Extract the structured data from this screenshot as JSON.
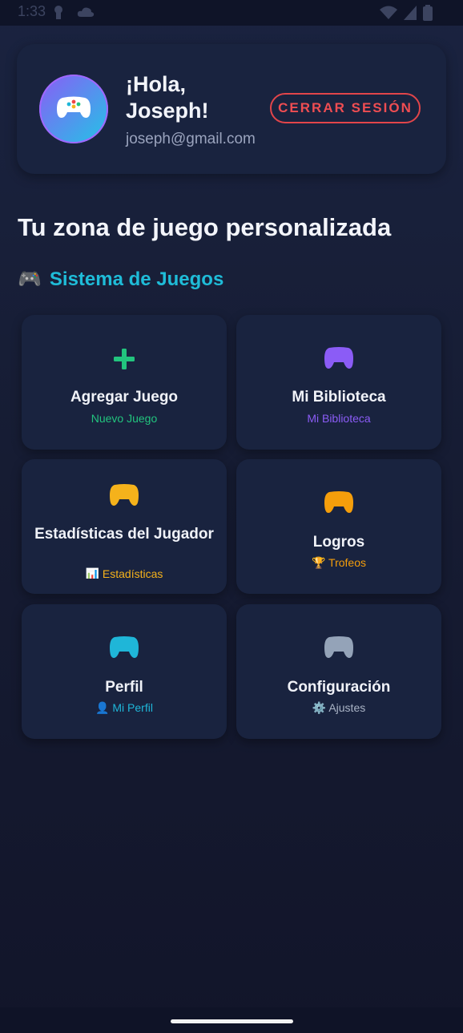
{
  "status_bar": {
    "time": "1:33"
  },
  "profile": {
    "greeting": "¡Hola, Joseph!",
    "email": "joseph@gmail.com",
    "logout_label": "CERRAR SESIÓN",
    "avatar_icon": "gamepad-icon"
  },
  "main": {
    "title": "Tu zona de juego personalizada",
    "section_title": "Sistema de Juegos",
    "section_emoji": "🎮"
  },
  "tiles": [
    {
      "title": "Agregar Juego",
      "subtitle": "Nuevo Juego",
      "icon": "plus-icon",
      "color": "#22c47e"
    },
    {
      "title": "Mi Biblioteca",
      "subtitle": "Mi Biblioteca",
      "icon": "gamepad-icon",
      "color": "#8b5cf6"
    },
    {
      "title": "Estadísticas del Jugador",
      "subtitle": "📊 Estadísticas",
      "icon": "gamepad-icon",
      "color": "#f5b21b"
    },
    {
      "title": "Logros",
      "subtitle": "🏆 Trofeos",
      "icon": "gamepad-icon",
      "color": "#f59e0b"
    },
    {
      "title": "Perfil",
      "subtitle": "👤 Mi Perfil",
      "icon": "gamepad-icon",
      "color": "#1fb6d8"
    },
    {
      "title": "Configuración",
      "subtitle": "⚙️ Ajustes",
      "icon": "gamepad-icon",
      "color": "#94a3b8"
    }
  ],
  "colors": {
    "accent_cyan": "#1fbcd8",
    "danger": "#e2454a",
    "card_bg": "#19233f"
  }
}
